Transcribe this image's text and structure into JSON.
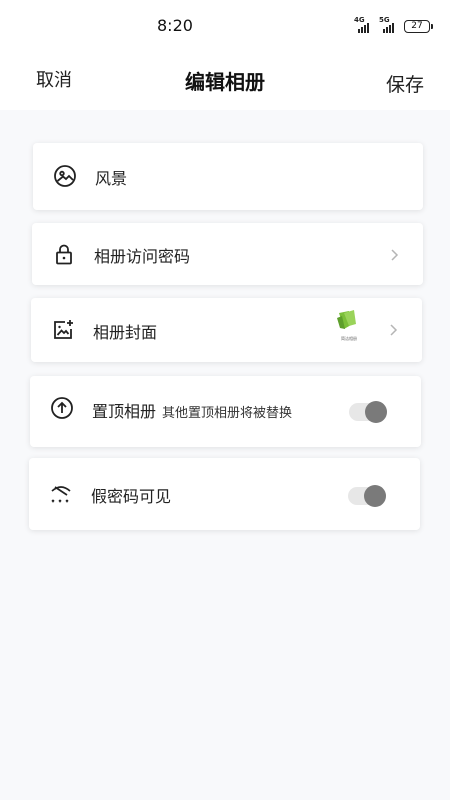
{
  "status_bar": {
    "time": "8:20",
    "network_1": "4G",
    "network_2": "5G",
    "battery": "27"
  },
  "header": {
    "cancel_label": "取消",
    "title": "编辑相册",
    "save_label": "保存"
  },
  "settings": {
    "scenery": {
      "label": "风景",
      "icon": "image-icon"
    },
    "access_password": {
      "label": "相册访问密码",
      "icon": "lock-icon"
    },
    "cover": {
      "label": "相册封面",
      "icon": "image-add-icon",
      "thumb_text": "简洁相册"
    },
    "pin_top": {
      "label": "置顶相册",
      "hint": "其他置顶相册将被替换",
      "icon": "upload-arrow-icon",
      "enabled": false
    },
    "fake_password": {
      "label": "假密码可见",
      "icon": "eye-off-icon",
      "enabled": false
    }
  },
  "colors": {
    "background": "#f8f9fb",
    "card": "#ffffff",
    "toggle_track": "#e7e7e7",
    "toggle_knob": "#7a7a7a"
  }
}
